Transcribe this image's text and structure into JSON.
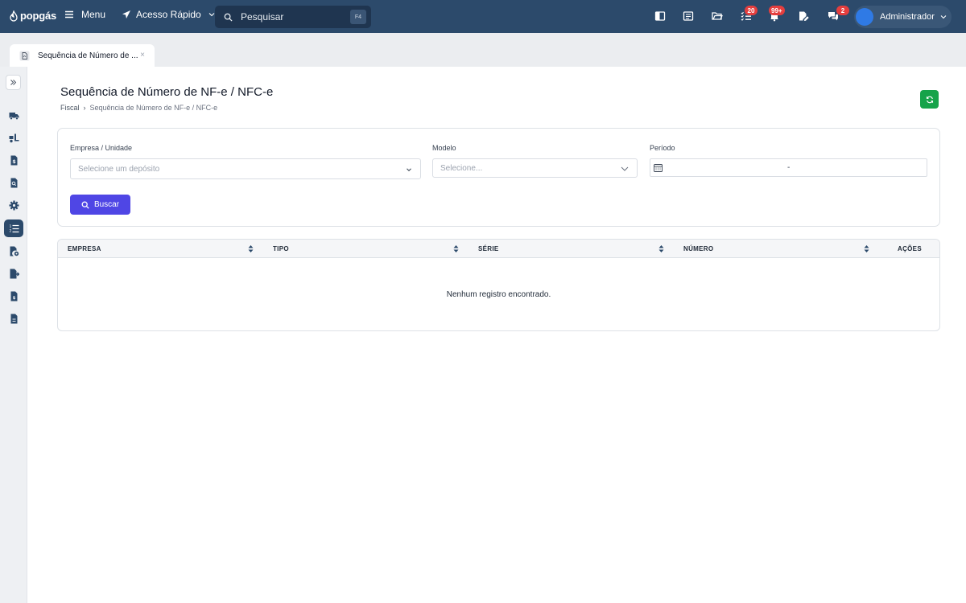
{
  "brand": {
    "logo_text": "popgás"
  },
  "topbar": {
    "menu_label": "Menu",
    "quick_access_label": "Acesso Rápido",
    "search": {
      "placeholder": "Pesquisar",
      "shortcut": "F4"
    },
    "badges": {
      "tasks": "20",
      "notifications": "99+",
      "messages": "2"
    },
    "user": {
      "name": "Administrador"
    }
  },
  "tabs": [
    {
      "label": "Sequência de Número de ...",
      "close": "×"
    }
  ],
  "sidebar": {
    "items": [
      {
        "icon": "truck-icon"
      },
      {
        "icon": "delivery-icon"
      },
      {
        "icon": "dollar-file-icon"
      },
      {
        "icon": "search-file-icon"
      },
      {
        "icon": "gear-icon"
      },
      {
        "icon": "list-icon",
        "active": true
      },
      {
        "icon": "file-gear-icon"
      },
      {
        "icon": "file-export-icon"
      },
      {
        "icon": "file-invoice-icon"
      },
      {
        "icon": "file-icon"
      }
    ]
  },
  "page": {
    "title": "Sequência de Número de NF-e / NFC-e",
    "breadcrumb": {
      "root": "Fiscal",
      "separator": "›",
      "current": "Sequência de Número de NF-e / NFC-e"
    }
  },
  "filters": {
    "empresa": {
      "label": "Empresa / Unidade",
      "placeholder": "Selecione um depósito"
    },
    "modelo": {
      "label": "Modelo",
      "placeholder": "Selecione..."
    },
    "periodo": {
      "label": "Período",
      "separator": "-"
    },
    "search_button": "Buscar"
  },
  "table": {
    "columns": [
      "EMPRESA",
      "TIPO",
      "SÉRIE",
      "NÚMERO",
      "AÇÕES"
    ],
    "empty_message": "Nenhum registro encontrado."
  },
  "colors": {
    "topbar": "#2c4a6b",
    "primary_button": "#4f46e5",
    "refresh_button": "#16a34a",
    "badge": "#e53e3e"
  }
}
